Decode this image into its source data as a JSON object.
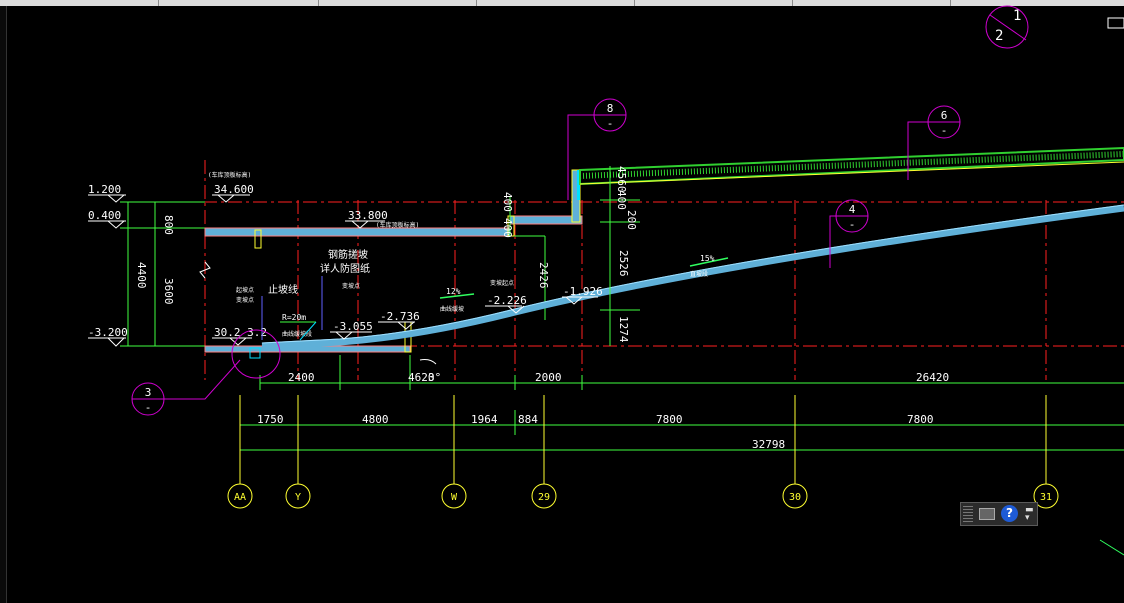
{
  "elevations": [
    {
      "id": "el-1200",
      "text": "1.200"
    },
    {
      "id": "el-0400",
      "text": "0.400"
    },
    {
      "id": "el-m3200",
      "text": "-3.200"
    },
    {
      "id": "el-34600",
      "text": "34.600"
    },
    {
      "id": "el-33800",
      "text": "33.800"
    },
    {
      "id": "el-m3055",
      "text": "-3.055"
    },
    {
      "id": "el-m2736",
      "text": "-2.736"
    },
    {
      "id": "el-m2226",
      "text": "-2.226"
    },
    {
      "id": "el-m1926",
      "text": "-1.926"
    },
    {
      "id": "el-3023",
      "text": "30.2 3.2"
    }
  ],
  "vertical_dims": [
    {
      "id": "vd-800",
      "text": "800"
    },
    {
      "id": "vd-4400",
      "text": "4400"
    },
    {
      "id": "vd-3600",
      "text": "3600"
    },
    {
      "id": "vd-400a",
      "text": "400"
    },
    {
      "id": "vd-400b",
      "text": "400"
    },
    {
      "id": "vd-2426",
      "text": "2426"
    },
    {
      "id": "vd-2526",
      "text": "2526"
    },
    {
      "id": "vd-1274",
      "text": "1274"
    },
    {
      "id": "vd-4560",
      "text": "4560"
    },
    {
      "id": "vd-400c",
      "text": "400"
    },
    {
      "id": "vd-200",
      "text": "200"
    }
  ],
  "dims_row1": [
    {
      "id": "d1-2400",
      "text": "2400"
    },
    {
      "id": "d1-4620",
      "text": "4620"
    },
    {
      "id": "d1-2000",
      "text": "2000"
    },
    {
      "id": "d1-26420",
      "text": "26420"
    }
  ],
  "dims_row2": [
    {
      "id": "d2-1750",
      "text": "1750"
    },
    {
      "id": "d2-4800",
      "text": "4800"
    },
    {
      "id": "d2-1964",
      "text": "1964"
    },
    {
      "id": "d2-884",
      "text": "884"
    },
    {
      "id": "d2-7800a",
      "text": "7800"
    },
    {
      "id": "d2-7800b",
      "text": "7800"
    }
  ],
  "dims_row3": {
    "total": "32798"
  },
  "axes": [
    {
      "id": "ax-aa",
      "label": "AA"
    },
    {
      "id": "ax-y",
      "label": "Y"
    },
    {
      "id": "ax-w",
      "label": "W"
    },
    {
      "id": "ax-29",
      "label": "29"
    },
    {
      "id": "ax-30",
      "label": "30"
    },
    {
      "id": "ax-31",
      "label": "31"
    }
  ],
  "detail_callouts": [
    {
      "id": "dc-8",
      "num": "8",
      "sheet": "-"
    },
    {
      "id": "dc-6",
      "num": "6",
      "sheet": "-"
    },
    {
      "id": "dc-4",
      "num": "4",
      "sheet": "-"
    },
    {
      "id": "dc-3",
      "num": "3",
      "sheet": "-"
    }
  ],
  "section_symbol": {
    "top": "1",
    "bottom": "2"
  },
  "slopes": [
    {
      "id": "sl-12",
      "text": "12%"
    },
    {
      "id": "sl-15",
      "text": "15%"
    }
  ],
  "annotations": {
    "radius": "R=20m",
    "stop_line": "止坡线",
    "steel_ramp": "钢筋搓坡",
    "see_drawing": "详人防图纸",
    "angle": "3°",
    "note_top1": "(车库顶板标高)",
    "note_top2": "(车库顶板标高)",
    "note_start": "起坡点",
    "note_change": "变坡点",
    "note_change2": "变坡点",
    "note_change3": "变坡点",
    "note_slope1": "曲线缓坡段",
    "note_slope2": "曲线缓坡",
    "note_slope3": "直坡段",
    "note_pt": "变坡起点"
  },
  "colors": {
    "grid_red": "#ff2020",
    "dim_green": "#40ff40",
    "ramp_blue": "#5fb0d8",
    "callout_magenta": "#d000d0",
    "axis_yellow": "#ffff30",
    "text_white": "#ffffff",
    "cyan": "#00e0ff",
    "slope_arrow": "#30ff60"
  },
  "nav_widget": {
    "help": "?"
  }
}
